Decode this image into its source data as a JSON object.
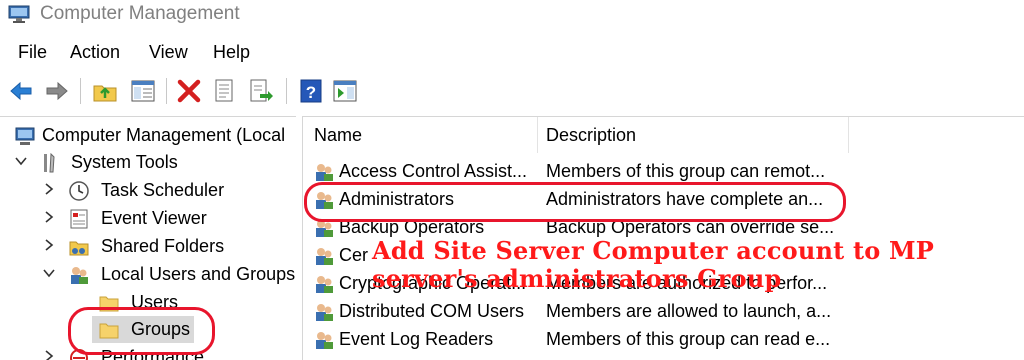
{
  "window": {
    "title": "Computer Management"
  },
  "menu": [
    "File",
    "Action",
    "View",
    "Help"
  ],
  "toolbar": {
    "buttons": [
      "back-arrow-icon",
      "forward-arrow-icon",
      "up-folder-icon",
      "show-hide-tree-icon",
      "delete-icon",
      "properties-icon",
      "export-list-icon",
      "help-icon",
      "show-action-pane-icon"
    ]
  },
  "tree": {
    "root": "Computer Management (Local",
    "system_tools": "System Tools",
    "task_scheduler": "Task Scheduler",
    "event_viewer": "Event Viewer",
    "shared_folders": "Shared Folders",
    "local_users_groups": "Local Users and Groups",
    "users": "Users",
    "groups": "Groups",
    "performance": "Performance"
  },
  "list": {
    "columns": [
      "Name",
      "Description"
    ],
    "rows": [
      {
        "name": "Access Control Assist...",
        "description": "Members of this group can remot..."
      },
      {
        "name": "Administrators",
        "description": "Administrators have complete an..."
      },
      {
        "name": "Backup Operators",
        "description": "Backup Operators can override se..."
      },
      {
        "name": "Cer",
        "description": ""
      },
      {
        "name": "Cryptographic Operat...",
        "description": "Members are authorized to perfor..."
      },
      {
        "name": "Distributed COM Users",
        "description": "Members are allowed to launch, a..."
      },
      {
        "name": "Event Log Readers",
        "description": "Members of this group can read e..."
      }
    ]
  },
  "annotation": {
    "line1": "Add Site Server  Computer account to MP",
    "line2": "server's administrators Group",
    "color": "#ff1a1a"
  }
}
